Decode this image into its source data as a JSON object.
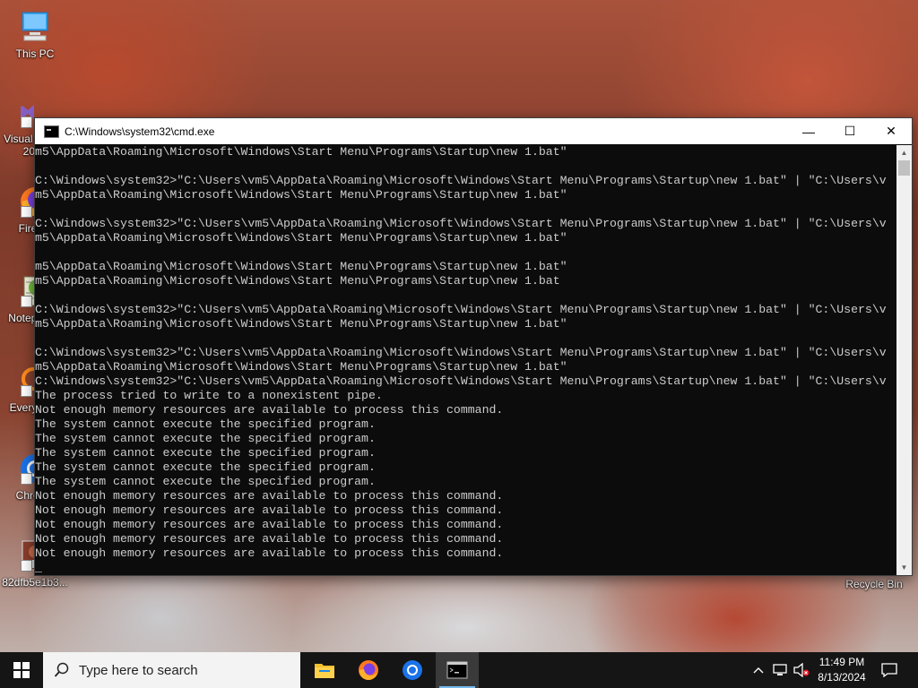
{
  "desktop": {
    "icons": [
      {
        "label": "This PC"
      },
      {
        "label": "Visual Studio 2022"
      },
      {
        "label": "Firefox"
      },
      {
        "label": "Notepad++"
      },
      {
        "label": "Everything"
      },
      {
        "label": "Chrome"
      },
      {
        "label": "82dfb5e1b3..."
      },
      {
        "label": "Recycle Bin"
      }
    ]
  },
  "window": {
    "title": "C:\\Windows\\system32\\cmd.exe",
    "minimize": "—",
    "maximize": "☐",
    "close": "✕",
    "lines": [
      "m5\\AppData\\Roaming\\Microsoft\\Windows\\Start Menu\\Programs\\Startup\\new 1.bat\"",
      "",
      "C:\\Windows\\system32>\"C:\\Users\\vm5\\AppData\\Roaming\\Microsoft\\Windows\\Start Menu\\Programs\\Startup\\new 1.bat\" | \"C:\\Users\\v",
      "m5\\AppData\\Roaming\\Microsoft\\Windows\\Start Menu\\Programs\\Startup\\new 1.bat\"",
      "",
      "C:\\Windows\\system32>\"C:\\Users\\vm5\\AppData\\Roaming\\Microsoft\\Windows\\Start Menu\\Programs\\Startup\\new 1.bat\" | \"C:\\Users\\v",
      "m5\\AppData\\Roaming\\Microsoft\\Windows\\Start Menu\\Programs\\Startup\\new 1.bat\"",
      "",
      "m5\\AppData\\Roaming\\Microsoft\\Windows\\Start Menu\\Programs\\Startup\\new 1.bat\"",
      "m5\\AppData\\Roaming\\Microsoft\\Windows\\Start Menu\\Programs\\Startup\\new 1.bat",
      "",
      "C:\\Windows\\system32>\"C:\\Users\\vm5\\AppData\\Roaming\\Microsoft\\Windows\\Start Menu\\Programs\\Startup\\new 1.bat\" | \"C:\\Users\\v",
      "m5\\AppData\\Roaming\\Microsoft\\Windows\\Start Menu\\Programs\\Startup\\new 1.bat\"",
      "",
      "C:\\Windows\\system32>\"C:\\Users\\vm5\\AppData\\Roaming\\Microsoft\\Windows\\Start Menu\\Programs\\Startup\\new 1.bat\" | \"C:\\Users\\v",
      "m5\\AppData\\Roaming\\Microsoft\\Windows\\Start Menu\\Programs\\Startup\\new 1.bat\"",
      "C:\\Windows\\system32>\"C:\\Users\\vm5\\AppData\\Roaming\\Microsoft\\Windows\\Start Menu\\Programs\\Startup\\new 1.bat\" | \"C:\\Users\\v",
      "The process tried to write to a nonexistent pipe.",
      "Not enough memory resources are available to process this command.",
      "The system cannot execute the specified program.",
      "The system cannot execute the specified program.",
      "The system cannot execute the specified program.",
      "The system cannot execute the specified program.",
      "The system cannot execute the specified program.",
      "Not enough memory resources are available to process this command.",
      "Not enough memory resources are available to process this command.",
      "Not enough memory resources are available to process this command.",
      "Not enough memory resources are available to process this command.",
      "Not enough memory resources are available to process this command.",
      "_"
    ]
  },
  "taskbar": {
    "search_placeholder": "Type here to search",
    "apps": [
      {
        "icon": "file-explorer-icon"
      },
      {
        "icon": "firefox-icon"
      },
      {
        "icon": "chrome-icon"
      },
      {
        "icon": "cmd-icon",
        "active": true
      }
    ],
    "clock": {
      "time": "11:49 PM",
      "date": "8/13/2024"
    }
  }
}
